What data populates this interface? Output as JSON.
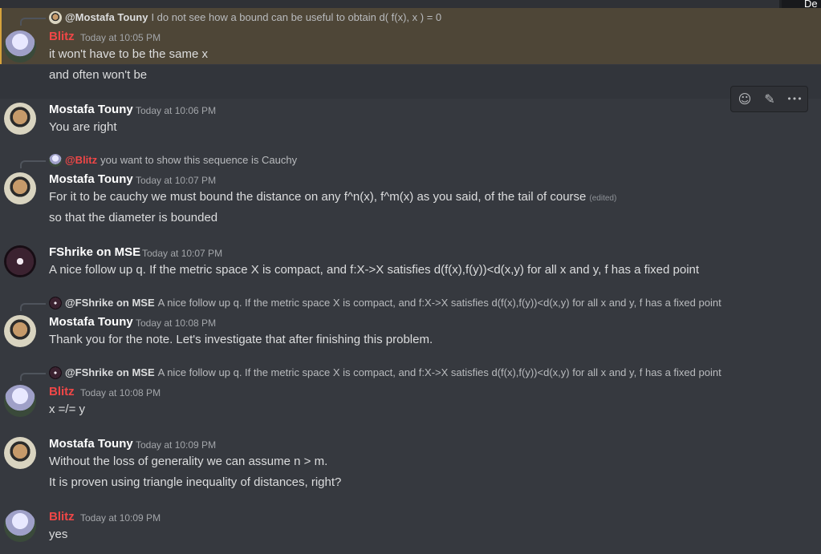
{
  "corner": {
    "text": "De"
  },
  "toolbar": {
    "react": "☺",
    "edit": "✎",
    "more": "•••"
  },
  "messages": [
    {
      "reply_to": "@Mostafa Touny",
      "reply_text": "I do not see how a bound can be useful to obtain d( f(x), x ) = 0",
      "author": "Blitz",
      "time": "Today at 10:05 PM",
      "lines": [
        "it won't have to be the same x",
        "and often won't be"
      ]
    },
    {
      "author": "Mostafa Touny",
      "time": "Today at 10:06 PM",
      "lines": [
        "You are right"
      ]
    },
    {
      "reply_to": "@Blitz",
      "reply_text": "you want to show this sequence is Cauchy",
      "author": "Mostafa Touny",
      "time": "Today at 10:07 PM",
      "lines": [
        "For it to be cauchy we must bound the distance on any f^n(x), f^m(x) as you said, of the tail of course",
        "so that the diameter is bounded"
      ],
      "edited": "(edited)"
    },
    {
      "author": "FShrike on MSE",
      "time": "Today at 10:07 PM",
      "lines": [
        "A nice follow up q. If the metric space X is compact, and f:X->X satisfies d(f(x),f(y))<d(x,y) for all x and y, f has a fixed point"
      ]
    },
    {
      "reply_to": "@FShrike on MSE",
      "reply_text": "A nice follow up q. If the metric space X is compact, and f:X->X satisfies d(f(x),f(y))<d(x,y) for all x and y, f has a fixed point",
      "author": "Mostafa Touny",
      "time": "Today at 10:08 PM",
      "lines": [
        "Thank you for the note. Let's investigate that after finishing this problem."
      ]
    },
    {
      "reply_to": "@FShrike on MSE",
      "reply_text": "A nice follow up q. If the metric space X is compact, and f:X->X satisfies d(f(x),f(y))<d(x,y) for all x and y, f has a fixed point",
      "author": "Blitz",
      "time": "Today at 10:08 PM",
      "lines": [
        "x =/= y"
      ]
    },
    {
      "author": "Mostafa Touny",
      "time": "Today at 10:09 PM",
      "lines": [
        "Without the loss of generality we can assume n > m.",
        "It is proven using triangle inequality of distances, right?"
      ]
    },
    {
      "author": "Blitz",
      "time": "Today at 10:09 PM",
      "lines": [
        "yes"
      ]
    }
  ]
}
